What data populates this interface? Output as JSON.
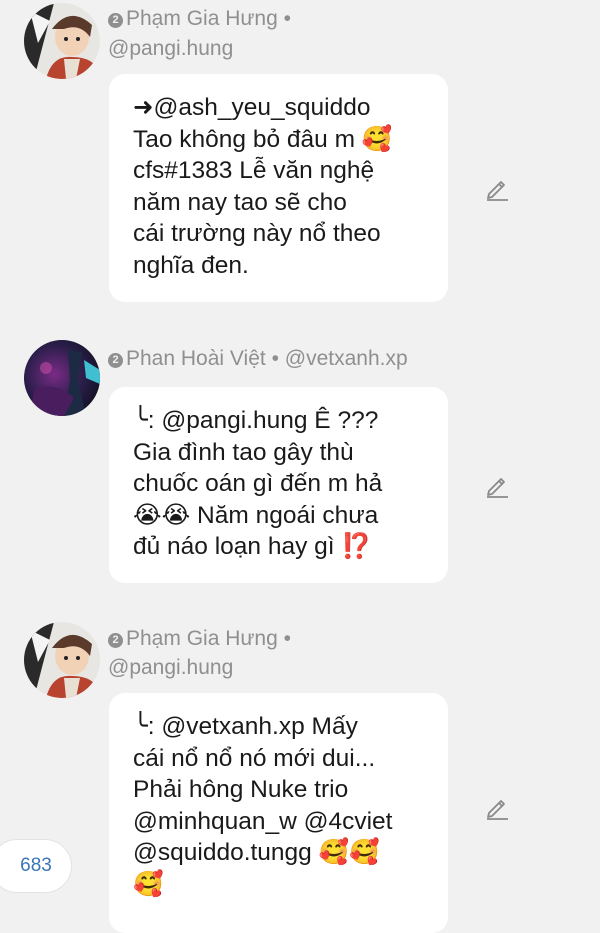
{
  "comments": [
    {
      "rank_badge": "2",
      "author_name": "Phạm Gia Hưng",
      "separator": "•",
      "handle": "@pangi.hung",
      "avatar": "avatar-illustrated-boy-icon",
      "lines": [
        "➜@ash_yeu_squiddo",
        "Tao không bỏ đâu m 🥰",
        "cfs#1383 Lễ văn nghệ",
        "năm nay tao sẽ cho",
        "cái trường này nổ theo",
        "nghĩa đen."
      ]
    },
    {
      "rank_badge": "2",
      "author_name": "Phan Hoài Việt",
      "separator": "•",
      "handle": "@vetxanh.xp",
      "avatar": "avatar-dark-figure-icon",
      "lines": [
        "╰: @pangi.hung Ê ???",
        "Gia đình tao gây thù",
        "chuốc oán gì đến m hả",
        "😭😭 Năm ngoái chưa",
        "đủ náo loạn hay gì ⁉️"
      ]
    },
    {
      "rank_badge": "2",
      "author_name": "Phạm Gia Hưng",
      "separator": "•",
      "handle": "@pangi.hung",
      "avatar": "avatar-illustrated-boy-icon",
      "lines": [
        "╰: @vetxanh.xp Mấy",
        "cái nổ nổ nó mới dui...",
        "Phải hông Nuke trio",
        "@minhquan_w @4cviet",
        "@squiddo.tungg 🥰🥰",
        "🥰"
      ]
    }
  ],
  "counter": {
    "value": "683"
  },
  "colors": {
    "background": "#f1f1f1",
    "bubble": "#ffffff",
    "meta_text": "#8f8f8f",
    "body_text": "#1a1a1a",
    "counter_text": "#3a76b6"
  }
}
